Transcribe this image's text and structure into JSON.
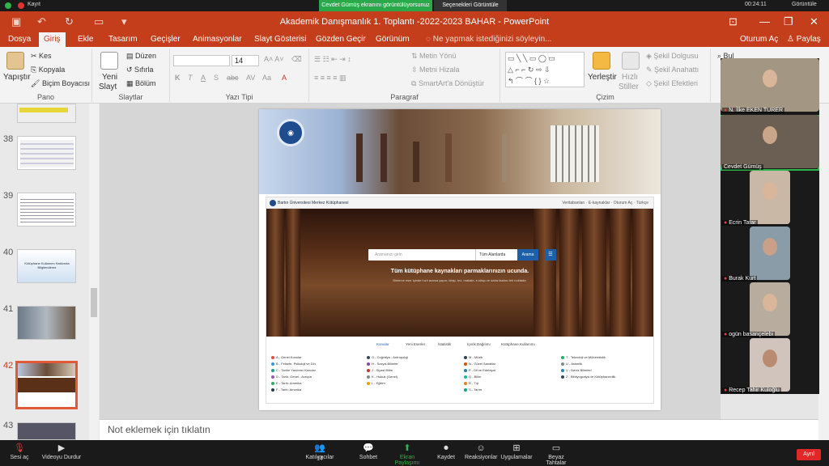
{
  "zoom_share_bar": {
    "recording_label": "Kayıt",
    "sharing_label": "Cevdet Gümüş ekranını görüntülüyorsunuz",
    "view_options": "Seçenekleri Görüntüle",
    "timer": "00:24:11",
    "gallery_view": "Görüntüle"
  },
  "window": {
    "title": "Akademik Danışmanlık 1. Toplantı -2022-2023 BAHAR - PowerPoint"
  },
  "ribbon_tabs": [
    "Dosya",
    "Giriş",
    "Ekle",
    "Tasarım",
    "Geçişler",
    "Animasyonlar",
    "Slayt Gösterisi",
    "Gözden Geçir",
    "Görünüm"
  ],
  "active_tab": "Giriş",
  "tell_me": "Ne yapmak istediğinizi söyleyin...",
  "sign_in": "Oturum Aç",
  "share": "Paylaş",
  "ribbon": {
    "pano": {
      "label": "Pano",
      "paste": "Yapıştır",
      "cut": "Kes",
      "copy": "Kopyala",
      "format_painter": "Biçim Boyacısı"
    },
    "slaytlar": {
      "label": "Slaytlar",
      "new_slide_1": "Yeni",
      "new_slide_2": "Slayt",
      "layout": "Düzen",
      "reset": "Sıfırla",
      "section": "Bölüm"
    },
    "yazi_tipi": {
      "label": "Yazı Tipi",
      "font_size": "14",
      "font_name": ""
    },
    "paragraf": {
      "label": "Paragraf",
      "text_direction": "Metin Yönü",
      "align_text": "Metni Hizala",
      "smartart": "SmartArt'a Dönüştür"
    },
    "cizim": {
      "label": "Çizim",
      "arrange": "Yerleştir",
      "quick_styles_1": "Hızlı",
      "quick_styles_2": "Stiller",
      "shape_fill": "Şekil Dolgusu",
      "shape_outline": "Şekil Anahattı",
      "shape_effects": "Şekil Efektleri"
    },
    "duzenleme": {
      "find": "Bul"
    }
  },
  "slide_thumbnails": [
    {
      "num": "38",
      "active": false
    },
    {
      "num": "39",
      "active": false
    },
    {
      "num": "40",
      "active": false,
      "caption": "Kütüphane Kullanımı Hakkında Bilgilendirme"
    },
    {
      "num": "41",
      "active": false
    },
    {
      "num": "42",
      "active": true
    },
    {
      "num": "43",
      "active": false
    }
  ],
  "slide": {
    "site_brand": "Bartın Üniversitesi Merkez Kütüphanesi",
    "site_links": "Veritabanları  ·  E-kaynaklar  ·  Oturum Aç  ·  Türkçe",
    "search_placeholder": "Aramanızı girin",
    "search_scope": "Tüm Alanlarda",
    "search_button": "Arama",
    "tagline": "Tüm kütüphane kaynakları parmaklarınızın ucunda.",
    "description": "Binlerce eser içinde hızlı arama yapın; kitap, tez, makale, e-kitap ve daha fazlası tek noktada.",
    "tabs": [
      "Konular",
      "Yeni Eserler",
      "İstatistik",
      "İçerik Dağılımı",
      "Kütüphane Kullanımı"
    ],
    "categories_col1": [
      "A - Genel Konular",
      "B - Felsefe, Psikoloji ve Din",
      "C - Tarihe Yardımcı Konular",
      "D - Tarih: Genel - Avrupa",
      "E - Tarih: Amerika",
      "F - Tarih: Amerika"
    ],
    "categories_col2": [
      "G - Coğrafya - Antropoloji",
      "H - Sosyal Bilimler",
      "J - Siyasi Bilim",
      "K - Hukuk (Genel)",
      "L - Eğitim"
    ],
    "categories_col3": [
      "M - Müzik",
      "N - Güzel Sanatlar",
      "P - Dil ve Edebiyat",
      "Q - Bilim",
      "R - Tıp",
      "S - Tarım"
    ],
    "categories_col4": [
      "T - Teknoloji ve Mühendislik",
      "U - Askerlik",
      "V - Deniz Bilimleri",
      "Z - Bibliyografya ve Kütüphanecilik"
    ]
  },
  "notes_placeholder": "Not eklemek için tıklatın",
  "participants": [
    {
      "name": "N. İlke EKEN TURER",
      "muted": true
    },
    {
      "name": "Cevdet Gümüş",
      "muted": false
    },
    {
      "name": "Ecrin Tatar",
      "muted": true
    },
    {
      "name": "Burak Kurt",
      "muted": true
    },
    {
      "name": "ogün basançelebi",
      "muted": true
    },
    {
      "name": "Recep Tahir Kuloğlu",
      "muted": true
    }
  ],
  "zoom_controls": {
    "audio": "Sesi aç",
    "video": "Videoyu Durdur",
    "participants_count": "14",
    "participants": "Katılımcılar",
    "chat": "Sohbet",
    "share_screen": "Ekran Paylaşımı",
    "record": "Kaydet",
    "reactions": "Reaksiyonlar",
    "apps": "Uygulamalar",
    "whiteboard": "Beyaz Tahtalar",
    "leave": "Ayrıl"
  },
  "colors": {
    "ppt_accent": "#c43e1c",
    "zoom_green": "#2db44a",
    "leave_red": "#e02828"
  }
}
